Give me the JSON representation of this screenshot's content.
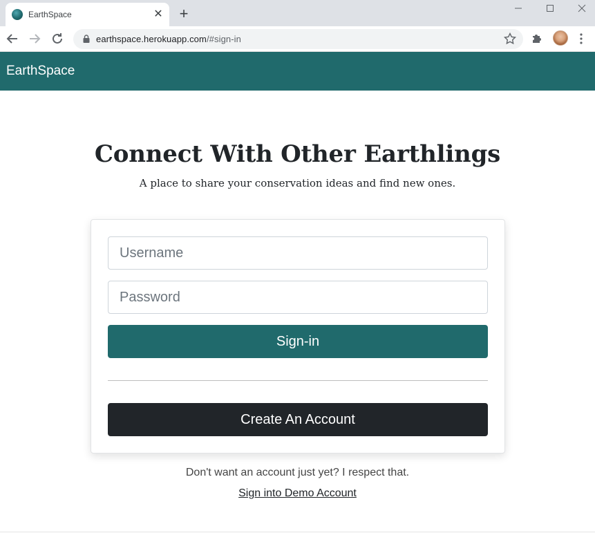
{
  "browser": {
    "tab_title": "EarthSpace",
    "tab_close_glyph": "✕",
    "new_tab_glyph": "+",
    "url_host": "earthspace.herokuapp.com",
    "url_path": "/#sign-in",
    "icons": [
      "earth-favicon-icon",
      "back-arrow-icon",
      "forward-arrow-icon",
      "reload-icon",
      "lock-icon",
      "star-icon",
      "extensions-puzzle-icon",
      "profile-avatar",
      "more-menu-icon"
    ]
  },
  "navbar": {
    "brand": "EarthSpace",
    "color": "#206a6c"
  },
  "hero": {
    "title": "Connect With Other Earthlings",
    "subtitle": "A place to share your conservation ideas and find new ones."
  },
  "form": {
    "username_placeholder": "Username",
    "password_placeholder": "Password",
    "signin_label": "Sign-in",
    "create_label": "Create An Account",
    "signin_color": "#206a6c",
    "create_color": "#212529"
  },
  "footer": {
    "note": "Don't want an account just yet? I respect that.",
    "demo_link": "Sign into Demo Account"
  }
}
